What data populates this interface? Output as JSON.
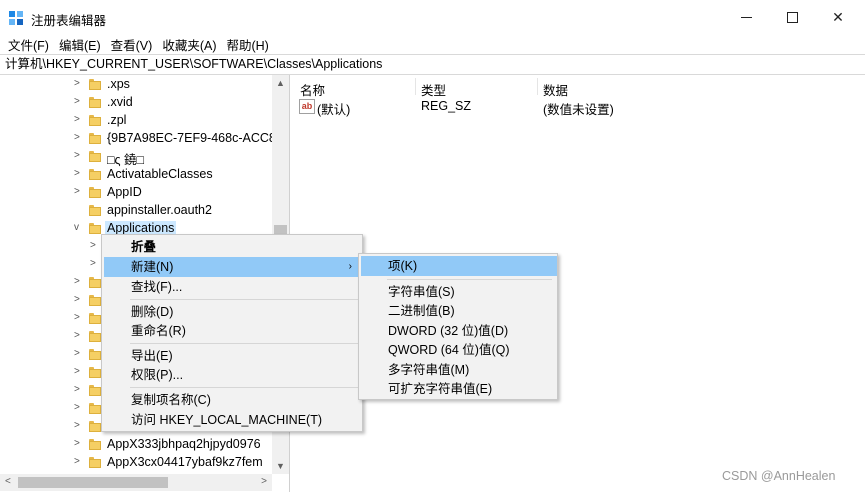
{
  "window": {
    "title": "注册表编辑器",
    "minimize_symbol": "",
    "close_symbol": "✕"
  },
  "menubar": {
    "items": [
      "文件(F)",
      "编辑(E)",
      "查看(V)",
      "收藏夹(A)",
      "帮助(H)"
    ]
  },
  "address": "计算机\\HKEY_CURRENT_USER\\SOFTWARE\\Classes\\Applications",
  "tree": {
    "items": [
      {
        "label": ".xps",
        "expandable": true
      },
      {
        "label": ".xvid",
        "expandable": true
      },
      {
        "label": ".zpl",
        "expandable": true
      },
      {
        "label": "{9B7A98EC-7EF9-468c-ACC8",
        "expandable": true
      },
      {
        "label": "□ς 鐃□",
        "expandable": true
      },
      {
        "label": "ActivatableClasses",
        "expandable": true
      },
      {
        "label": "AppID",
        "expandable": true
      },
      {
        "label": "appinstaller.oauth2",
        "expandable": true
      },
      {
        "label": "Applications",
        "expandable": true,
        "expanded": true,
        "selected": true
      }
    ],
    "bottom_items": [
      {
        "label": "AppX333jbhpaq2hjpyd0976",
        "expandable": true
      },
      {
        "label": "AppX3cx04417ybaf9kz7fem",
        "expandable": true
      }
    ]
  },
  "values_pane": {
    "columns": [
      "名称",
      "类型",
      "数据"
    ],
    "rows": [
      {
        "icon": "ab",
        "name": "(默认)",
        "type": "REG_SZ",
        "data": "(数值未设置)"
      }
    ]
  },
  "context_menu": {
    "items": [
      "折叠",
      "新建(N)",
      "查找(F)...",
      "删除(D)",
      "重命名(R)",
      "导出(E)",
      "权限(P)...",
      "复制项名称(C)",
      "访问 HKEY_LOCAL_MACHINE(T)"
    ],
    "highlighted": "新建(N)",
    "submenu_arrow": "›"
  },
  "submenu": {
    "items": [
      "项(K)",
      "字符串值(S)",
      "二进制值(B)",
      "DWORD (32 位)值(D)",
      "QWORD (64 位)值(Q)",
      "多字符串值(M)",
      "可扩充字符串值(E)"
    ],
    "highlighted": "项(K)"
  },
  "watermark": "CSDN @AnnHealen",
  "colors": {
    "highlight": "#91c9f7",
    "tree_selected": "#cce8ff",
    "folder": "#f5cf64"
  }
}
